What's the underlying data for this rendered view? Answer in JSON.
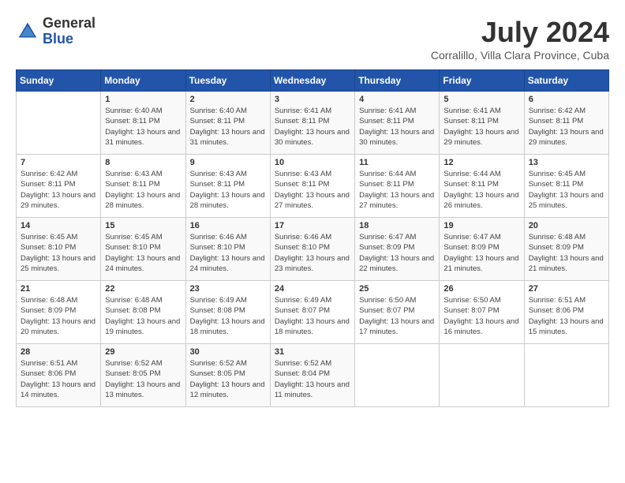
{
  "header": {
    "logo": {
      "general": "General",
      "blue": "Blue"
    },
    "title": "July 2024",
    "location": "Corralillo, Villa Clara Province, Cuba"
  },
  "calendar": {
    "days_of_week": [
      "Sunday",
      "Monday",
      "Tuesday",
      "Wednesday",
      "Thursday",
      "Friday",
      "Saturday"
    ],
    "weeks": [
      [
        {
          "day": "",
          "info": ""
        },
        {
          "day": "1",
          "info": "Sunrise: 6:40 AM\nSunset: 8:11 PM\nDaylight: 13 hours and 31 minutes."
        },
        {
          "day": "2",
          "info": "Sunrise: 6:40 AM\nSunset: 8:11 PM\nDaylight: 13 hours and 31 minutes."
        },
        {
          "day": "3",
          "info": "Sunrise: 6:41 AM\nSunset: 8:11 PM\nDaylight: 13 hours and 30 minutes."
        },
        {
          "day": "4",
          "info": "Sunrise: 6:41 AM\nSunset: 8:11 PM\nDaylight: 13 hours and 30 minutes."
        },
        {
          "day": "5",
          "info": "Sunrise: 6:41 AM\nSunset: 8:11 PM\nDaylight: 13 hours and 29 minutes."
        },
        {
          "day": "6",
          "info": "Sunrise: 6:42 AM\nSunset: 8:11 PM\nDaylight: 13 hours and 29 minutes."
        }
      ],
      [
        {
          "day": "7",
          "info": "Sunrise: 6:42 AM\nSunset: 8:11 PM\nDaylight: 13 hours and 29 minutes."
        },
        {
          "day": "8",
          "info": "Sunrise: 6:43 AM\nSunset: 8:11 PM\nDaylight: 13 hours and 28 minutes."
        },
        {
          "day": "9",
          "info": "Sunrise: 6:43 AM\nSunset: 8:11 PM\nDaylight: 13 hours and 28 minutes."
        },
        {
          "day": "10",
          "info": "Sunrise: 6:43 AM\nSunset: 8:11 PM\nDaylight: 13 hours and 27 minutes."
        },
        {
          "day": "11",
          "info": "Sunrise: 6:44 AM\nSunset: 8:11 PM\nDaylight: 13 hours and 27 minutes."
        },
        {
          "day": "12",
          "info": "Sunrise: 6:44 AM\nSunset: 8:11 PM\nDaylight: 13 hours and 26 minutes."
        },
        {
          "day": "13",
          "info": "Sunrise: 6:45 AM\nSunset: 8:11 PM\nDaylight: 13 hours and 25 minutes."
        }
      ],
      [
        {
          "day": "14",
          "info": "Sunrise: 6:45 AM\nSunset: 8:10 PM\nDaylight: 13 hours and 25 minutes."
        },
        {
          "day": "15",
          "info": "Sunrise: 6:45 AM\nSunset: 8:10 PM\nDaylight: 13 hours and 24 minutes."
        },
        {
          "day": "16",
          "info": "Sunrise: 6:46 AM\nSunset: 8:10 PM\nDaylight: 13 hours and 24 minutes."
        },
        {
          "day": "17",
          "info": "Sunrise: 6:46 AM\nSunset: 8:10 PM\nDaylight: 13 hours and 23 minutes."
        },
        {
          "day": "18",
          "info": "Sunrise: 6:47 AM\nSunset: 8:09 PM\nDaylight: 13 hours and 22 minutes."
        },
        {
          "day": "19",
          "info": "Sunrise: 6:47 AM\nSunset: 8:09 PM\nDaylight: 13 hours and 21 minutes."
        },
        {
          "day": "20",
          "info": "Sunrise: 6:48 AM\nSunset: 8:09 PM\nDaylight: 13 hours and 21 minutes."
        }
      ],
      [
        {
          "day": "21",
          "info": "Sunrise: 6:48 AM\nSunset: 8:09 PM\nDaylight: 13 hours and 20 minutes."
        },
        {
          "day": "22",
          "info": "Sunrise: 6:48 AM\nSunset: 8:08 PM\nDaylight: 13 hours and 19 minutes."
        },
        {
          "day": "23",
          "info": "Sunrise: 6:49 AM\nSunset: 8:08 PM\nDaylight: 13 hours and 18 minutes."
        },
        {
          "day": "24",
          "info": "Sunrise: 6:49 AM\nSunset: 8:07 PM\nDaylight: 13 hours and 18 minutes."
        },
        {
          "day": "25",
          "info": "Sunrise: 6:50 AM\nSunset: 8:07 PM\nDaylight: 13 hours and 17 minutes."
        },
        {
          "day": "26",
          "info": "Sunrise: 6:50 AM\nSunset: 8:07 PM\nDaylight: 13 hours and 16 minutes."
        },
        {
          "day": "27",
          "info": "Sunrise: 6:51 AM\nSunset: 8:06 PM\nDaylight: 13 hours and 15 minutes."
        }
      ],
      [
        {
          "day": "28",
          "info": "Sunrise: 6:51 AM\nSunset: 8:06 PM\nDaylight: 13 hours and 14 minutes."
        },
        {
          "day": "29",
          "info": "Sunrise: 6:52 AM\nSunset: 8:05 PM\nDaylight: 13 hours and 13 minutes."
        },
        {
          "day": "30",
          "info": "Sunrise: 6:52 AM\nSunset: 8:05 PM\nDaylight: 13 hours and 12 minutes."
        },
        {
          "day": "31",
          "info": "Sunrise: 6:52 AM\nSunset: 8:04 PM\nDaylight: 13 hours and 11 minutes."
        },
        {
          "day": "",
          "info": ""
        },
        {
          "day": "",
          "info": ""
        },
        {
          "day": "",
          "info": ""
        }
      ]
    ]
  }
}
